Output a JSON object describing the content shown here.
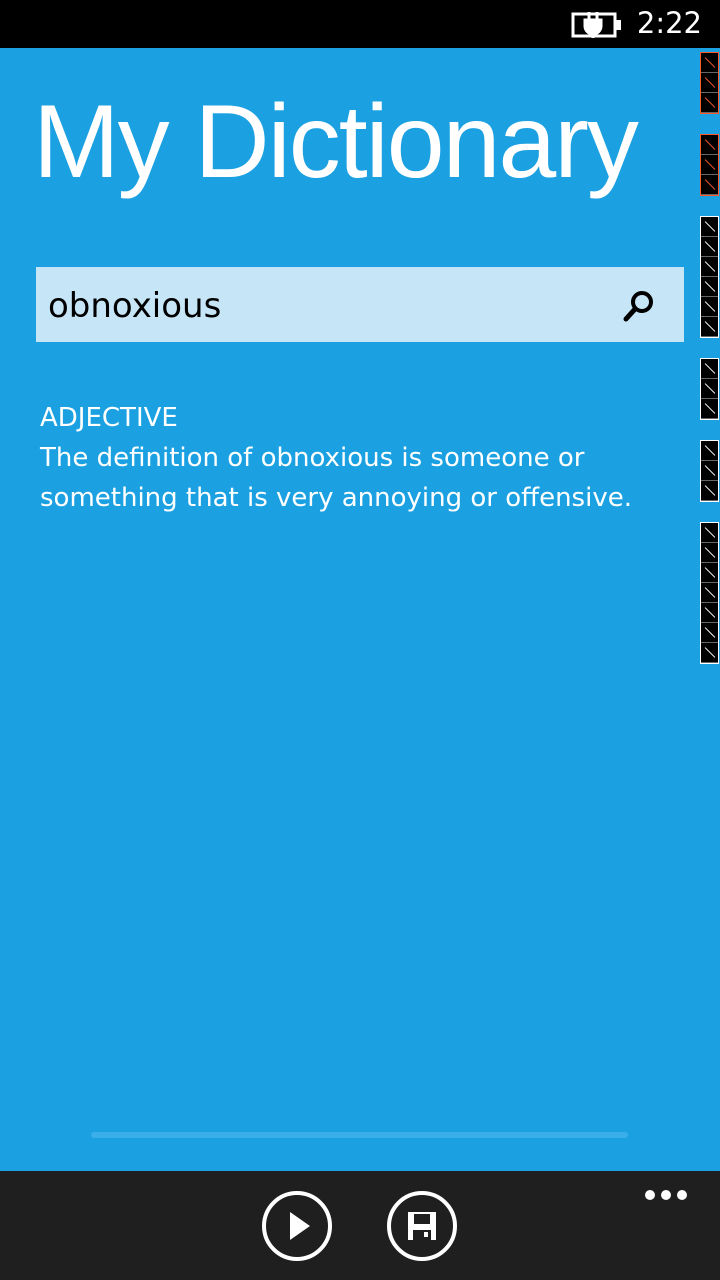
{
  "status_bar": {
    "time": "2:22",
    "icons": [
      "battery-charging-icon"
    ]
  },
  "app": {
    "title": "My Dictionary"
  },
  "search": {
    "value": "obnoxious",
    "icon": "search-icon"
  },
  "definition": {
    "part_of_speech": "ADJECTIVE",
    "text": "The definition of obnoxious is someone or something that is very annoying or offensive."
  },
  "app_bar": {
    "buttons": [
      {
        "name": "play-button",
        "icon": "play-icon"
      },
      {
        "name": "save-button",
        "icon": "save-icon"
      }
    ],
    "more_icon": "more-icon"
  },
  "colors": {
    "accent": "#1ba1e2",
    "search_background": "#c6e6f7",
    "app_bar_background": "#1f1f1f",
    "status_bar_background": "#000000"
  }
}
